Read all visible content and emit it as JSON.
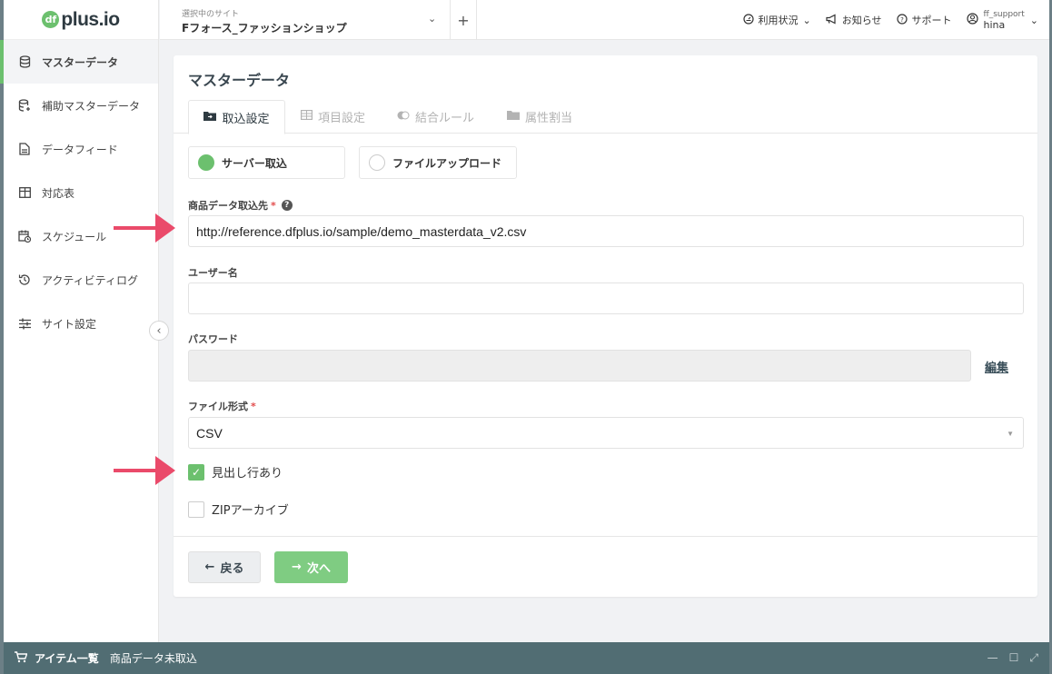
{
  "logo": {
    "mark": "df",
    "text": "plus.io"
  },
  "topbar": {
    "site_caption": "選択中のサイト",
    "site_name": "Fフォース_ファッションショップ",
    "add": "+",
    "usage": "利用状況",
    "news": "お知らせ",
    "support": "サポート",
    "user_id": "ff_support",
    "user_name": "hina"
  },
  "sidebar": {
    "items": [
      {
        "label": "マスターデータ",
        "icon": "database-icon"
      },
      {
        "label": "補助マスターデータ",
        "icon": "database-plus-icon"
      },
      {
        "label": "データフィード",
        "icon": "file-icon"
      },
      {
        "label": "対応表",
        "icon": "table-icon"
      },
      {
        "label": "スケジュール",
        "icon": "calendar-clock-icon"
      },
      {
        "label": "アクティビティログ",
        "icon": "history-icon"
      },
      {
        "label": "サイト設定",
        "icon": "sliders-icon"
      }
    ]
  },
  "panel": {
    "title": "マスターデータ",
    "tabs": [
      {
        "label": "取込設定",
        "icon": "folder-import-icon",
        "active": true
      },
      {
        "label": "項目設定",
        "icon": "grid-icon",
        "active": false
      },
      {
        "label": "結合ルール",
        "icon": "toggle-icon",
        "active": false
      },
      {
        "label": "属性割当",
        "icon": "folder-icon",
        "active": false
      }
    ],
    "source_options": [
      {
        "label": "サーバー取込",
        "selected": true
      },
      {
        "label": "ファイルアップロード",
        "selected": false
      }
    ],
    "url_label": "商品データ取込先",
    "required_mark": "*",
    "help": "?",
    "url_value": "http://reference.dfplus.io/sample/demo_masterdata_v2.csv",
    "username_label": "ユーザー名",
    "username_value": "",
    "password_label": "パスワード",
    "password_value": "",
    "edit_label": "編集",
    "format_label": "ファイル形式",
    "format_value": "CSV",
    "header_row_label": "見出し行あり",
    "header_row_checked": true,
    "zip_label": "ZIPアーカイブ",
    "zip_checked": false,
    "back_label": "戻る",
    "next_label": "次へ"
  },
  "statusbar": {
    "title": "アイテム一覧",
    "status": "商品データ未取込"
  },
  "colors": {
    "accent": "#6cc06e",
    "arrow": "#ea4a6a",
    "statusbar": "#516d73"
  }
}
